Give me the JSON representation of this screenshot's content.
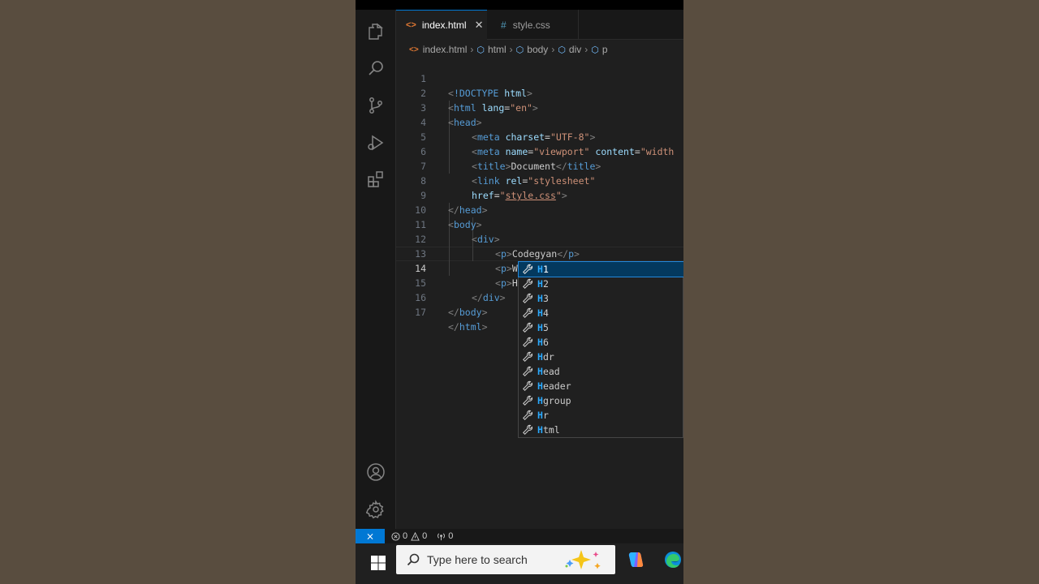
{
  "tabs": [
    {
      "label": "index.html",
      "icon": "html-file-icon",
      "active": true
    },
    {
      "label": "style.css",
      "icon": "css-file-icon",
      "active": false
    }
  ],
  "breadcrumb": [
    "index.html",
    "html",
    "body",
    "div",
    "p"
  ],
  "editor": {
    "current_line": 14,
    "lines": [
      {
        "n": "1"
      },
      {
        "n": "2"
      },
      {
        "n": "3"
      },
      {
        "n": "4"
      },
      {
        "n": "5"
      },
      {
        "n": "6"
      },
      {
        "n": "7"
      },
      {
        "n": "8"
      },
      {
        "n": "9"
      },
      {
        "n": "10"
      },
      {
        "n": "11"
      },
      {
        "n": "12"
      },
      {
        "n": "13"
      },
      {
        "n": "14"
      },
      {
        "n": "15"
      },
      {
        "n": "16"
      },
      {
        "n": "17"
      }
    ],
    "code": {
      "l1_doctype": "!DOCTYPE",
      "l1_html": "html",
      "l2_tag": "html",
      "l2_attr": "lang",
      "l2_val": "\"en\"",
      "l3_tag": "head",
      "l4_tag": "meta",
      "l4_attr": "charset",
      "l4_val": "\"UTF-8\"",
      "l5_tag": "meta",
      "l5_attr1": "name",
      "l5_val1": "\"viewport\"",
      "l5_attr2": "content",
      "l5_val2": "\"width",
      "l6_tag": "title",
      "l6_text": "Document",
      "l7_tag": "link",
      "l7_attr": "rel",
      "l7_val": "\"stylesheet\"",
      "l8_attr": "href",
      "l8_val_q1": "\"",
      "l8_val": "style.css",
      "l8_val_q2": "\"",
      "l9_tag": "head",
      "l10_tag": "body",
      "l11_tag": "div",
      "l12_tag": "p",
      "l12_text": "Codegyan",
      "l13_tag": "p",
      "l13_text": "With",
      "l14_tag": "p",
      "l14_text": "H",
      "l15_tag": "div",
      "l16_tag": "body",
      "l17_tag": "html"
    }
  },
  "suggestions": [
    {
      "match": "H",
      "rest": "1"
    },
    {
      "match": "H",
      "rest": "2"
    },
    {
      "match": "H",
      "rest": "3"
    },
    {
      "match": "H",
      "rest": "4"
    },
    {
      "match": "H",
      "rest": "5"
    },
    {
      "match": "H",
      "rest": "6"
    },
    {
      "match": "H",
      "rest": "dr"
    },
    {
      "match": "H",
      "rest": "ead"
    },
    {
      "match": "H",
      "rest": "eader"
    },
    {
      "match": "H",
      "rest": "group"
    },
    {
      "match": "H",
      "rest": "r"
    },
    {
      "match": "H",
      "rest": "tml"
    }
  ],
  "statusbar": {
    "errors": "0",
    "warnings": "0",
    "ports": "0"
  },
  "taskbar": {
    "search_placeholder": "Type here to search"
  },
  "colors": {
    "accent": "#0078d4",
    "tag": "#569cd6",
    "attr": "#9cdcfe",
    "string": "#ce9178",
    "match": "#2aaaff"
  }
}
